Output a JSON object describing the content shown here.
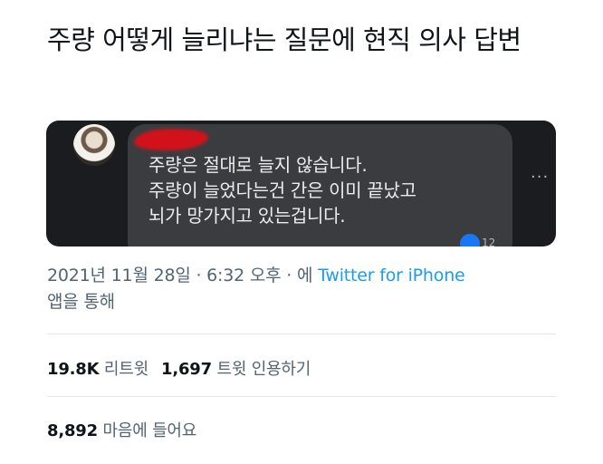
{
  "tweet": {
    "text": "주량 어떻게 늘리냐는 질문에 현직 의사 답변"
  },
  "media": {
    "comment_lines": [
      "주량은 절대로 늘지 않습니다.",
      "주량이 늘었다는건 간은 이미 끝났고",
      "뇌가 망가지고 있는겁니다."
    ],
    "reaction_count": "12",
    "more_label": "···"
  },
  "meta": {
    "date": "2021년 11월 28일",
    "sep1": " · ",
    "time": "6:32 오후",
    "sep2": " · ",
    "via_prefix": "에 ",
    "source": "Twitter for iPhone",
    "via_suffix": "앱을 통해"
  },
  "stats": {
    "retweets": {
      "count": "19.8K",
      "label": "리트윗"
    },
    "quotes": {
      "count": "1,697",
      "label": "트윗 인용하기"
    },
    "likes": {
      "count": "8,892",
      "label": "마음에 들어요"
    }
  }
}
